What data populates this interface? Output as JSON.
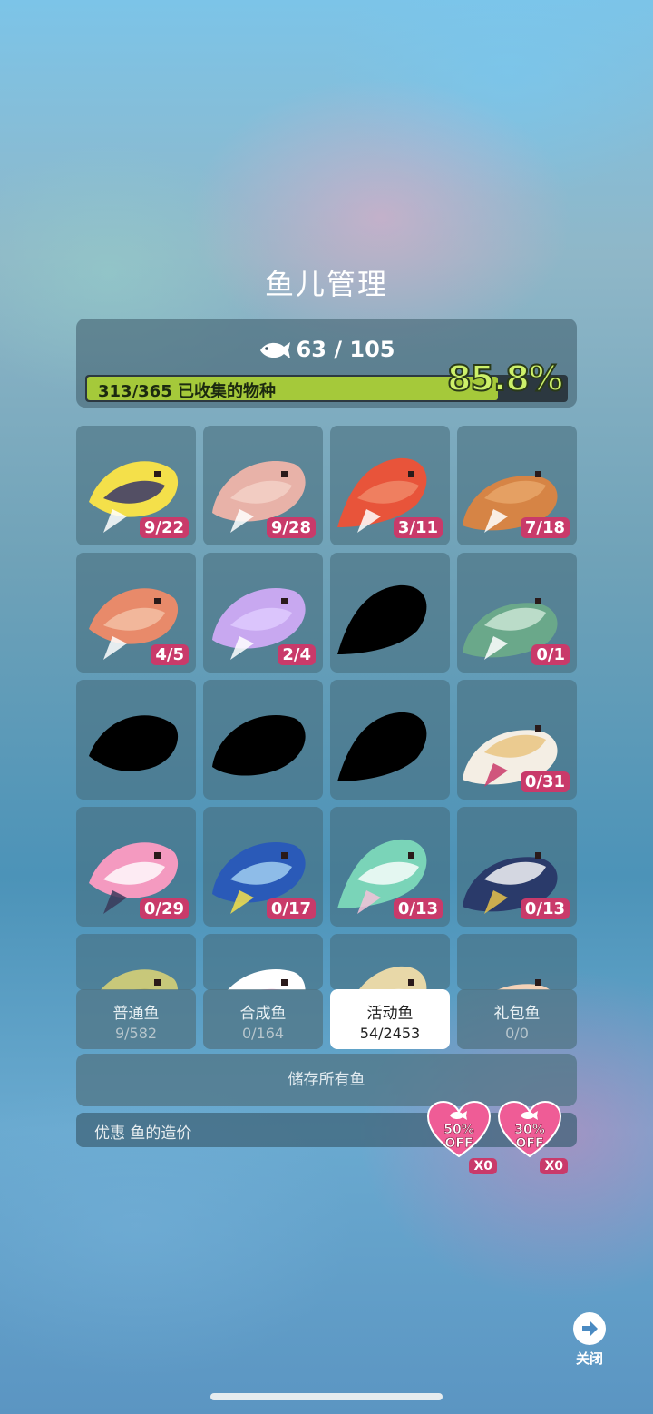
{
  "title": "鱼儿管理",
  "summary": {
    "fish_icon": "fish-icon",
    "count": "63 / 105",
    "progress_text": "313/365 已收集的物种",
    "progress_fraction": 0.858,
    "progress_percent": "85.8%"
  },
  "fish": [
    {
      "name": "yellow-striped-fish",
      "count": "9/22",
      "colors": [
        "#f4e04a",
        "#2a2a6a",
        "#ffffff"
      ]
    },
    {
      "name": "pink-rockfish",
      "count": "9/28",
      "colors": [
        "#e8b2a8",
        "#f4d2c8",
        "#ffffff"
      ]
    },
    {
      "name": "red-rockfish",
      "count": "3/11",
      "colors": [
        "#e8543a",
        "#f08a6a",
        "#ffffff"
      ]
    },
    {
      "name": "orange-scorpionfish",
      "count": "7/18",
      "colors": [
        "#d68445",
        "#e9a86a",
        "#ffffff"
      ]
    },
    {
      "name": "spotted-grouper",
      "count": "4/5",
      "colors": [
        "#e88a6a",
        "#f4c2a8",
        "#ffffff"
      ]
    },
    {
      "name": "purple-octopus",
      "count": "2/4",
      "colors": [
        "#c8a8f0",
        "#e0ccff",
        "#ffffff"
      ]
    },
    {
      "name": "locked-silhouette-1",
      "count": "",
      "colors": [
        "#000000",
        "#000000",
        "#000000"
      ]
    },
    {
      "name": "green-gharial",
      "count": "0/1",
      "colors": [
        "#6aa88a",
        "#cfe8d8",
        "#ffffff"
      ]
    },
    {
      "name": "locked-silhouette-2",
      "count": "",
      "colors": [
        "#000000",
        "#000000",
        "#000000"
      ]
    },
    {
      "name": "locked-silhouette-3",
      "count": "",
      "colors": [
        "#000000",
        "#000000",
        "#000000"
      ]
    },
    {
      "name": "locked-silhouette-4",
      "count": "",
      "colors": [
        "#000000",
        "#000000",
        "#000000"
      ]
    },
    {
      "name": "festive-sheep-fish",
      "count": "0/31",
      "colors": [
        "#f4eee4",
        "#e8c27a",
        "#c93a6a"
      ]
    },
    {
      "name": "balloon-clownfish",
      "count": "0/29",
      "colors": [
        "#f49ac0",
        "#ffffff",
        "#3a3a5a"
      ]
    },
    {
      "name": "balloon-blue-tang",
      "count": "0/17",
      "colors": [
        "#2a5ab8",
        "#a8d4f4",
        "#f4e04a"
      ]
    },
    {
      "name": "flower-turtle",
      "count": "0/13",
      "colors": [
        "#7ad4b8",
        "#ffffff",
        "#f4c2d8"
      ]
    },
    {
      "name": "captain-swordfish",
      "count": "0/13",
      "colors": [
        "#2a3a6a",
        "#ffffff",
        "#e8c24a"
      ]
    },
    {
      "name": "partial-green-fish",
      "count": "",
      "colors": [
        "#c8c87a",
        "#9a9a4a",
        "#ffffff"
      ]
    },
    {
      "name": "partial-candle-fish",
      "count": "",
      "colors": [
        "#ffffff",
        "#f49ac0",
        "#c93a6a"
      ]
    },
    {
      "name": "partial-bone-fish",
      "count": "",
      "colors": [
        "#e8d8a8",
        "#ffffff",
        "#a89a6a"
      ]
    },
    {
      "name": "partial-cloud-fish",
      "count": "",
      "colors": [
        "#f4d2b8",
        "#a8d4f4",
        "#ffffff"
      ]
    }
  ],
  "tabs": [
    {
      "label": "普通鱼",
      "count": "9/582",
      "active": false
    },
    {
      "label": "合成鱼",
      "count": "0/164",
      "active": false
    },
    {
      "label": "活动鱼",
      "count": "54/2453",
      "active": true
    },
    {
      "label": "礼包鱼",
      "count": "0/0",
      "active": false
    }
  ],
  "store_all_label": "储存所有鱼",
  "discount": {
    "label": "优惠 鱼的造价",
    "coupons": [
      {
        "percent": "50%",
        "off": "OFF",
        "qty": "X0",
        "color": "#ef5c96"
      },
      {
        "percent": "30%",
        "off": "OFF",
        "qty": "X0",
        "color": "#ef5c96"
      }
    ]
  },
  "close_label": "关闭",
  "colors": {
    "accent_green": "#a5c93a",
    "badge_pink": "#c93a6a",
    "heart_pink": "#ef5c96"
  }
}
